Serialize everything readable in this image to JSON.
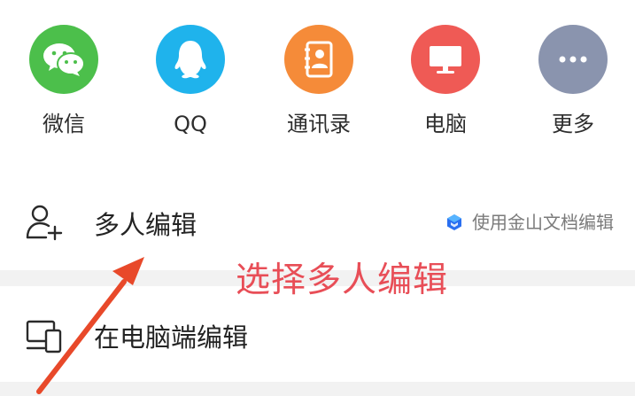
{
  "share_targets": [
    {
      "label": "微信",
      "icon": "wechat-icon",
      "color": "#4cbf4b"
    },
    {
      "label": "QQ",
      "icon": "qq-icon",
      "color": "#1fb3ec"
    },
    {
      "label": "通讯录",
      "icon": "contacts-icon",
      "color": "#f58b39"
    },
    {
      "label": "电脑",
      "icon": "computer-icon",
      "color": "#ef5a55"
    },
    {
      "label": "更多",
      "icon": "more-icon",
      "color": "#8a94ae"
    }
  ],
  "options": {
    "multi_edit": {
      "label": "多人编辑",
      "icon": "add-user-icon",
      "hint": "使用金山文档编辑",
      "hint_icon": "kingsoft-docs-logo-icon"
    },
    "pc_edit": {
      "label": "在电脑端编辑",
      "icon": "devices-icon"
    }
  },
  "annotation": {
    "text": "选择多人编辑",
    "color": "#e84e57"
  }
}
